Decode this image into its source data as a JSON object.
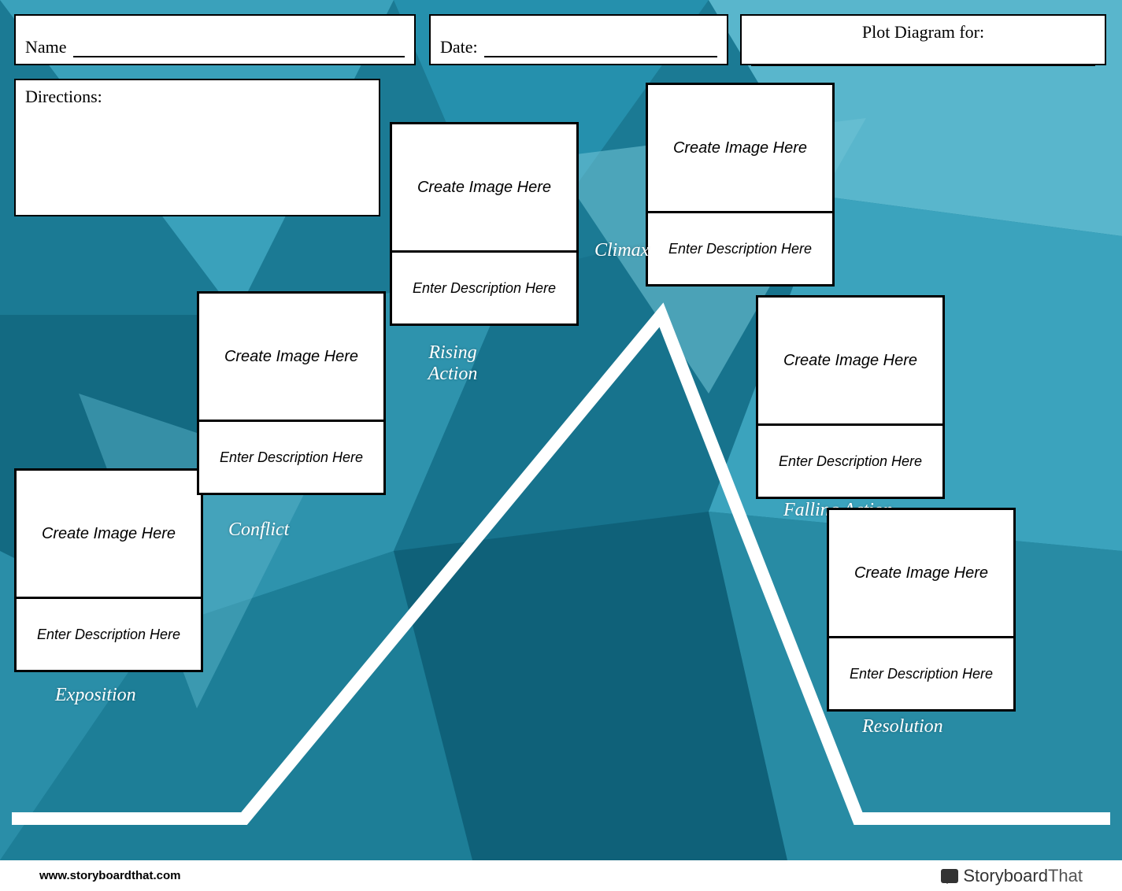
{
  "header": {
    "name_label": "Name",
    "date_label": "Date:",
    "plotfor_label": "Plot Diagram for:"
  },
  "directions_label": "Directions:",
  "placeholders": {
    "image": "Create Image Here",
    "description": "Enter Description Here"
  },
  "stages": {
    "exposition": {
      "label": "Exposition"
    },
    "conflict": {
      "label": "Conflict"
    },
    "rising": {
      "label": "Rising Action"
    },
    "climax": {
      "label": "Climax"
    },
    "falling": {
      "label": "Falling Action"
    },
    "resolution": {
      "label": "Resolution"
    }
  },
  "footer": {
    "url": "www.storyboardthat.com",
    "brand_part1": "Storyboard",
    "brand_part2": "That"
  }
}
